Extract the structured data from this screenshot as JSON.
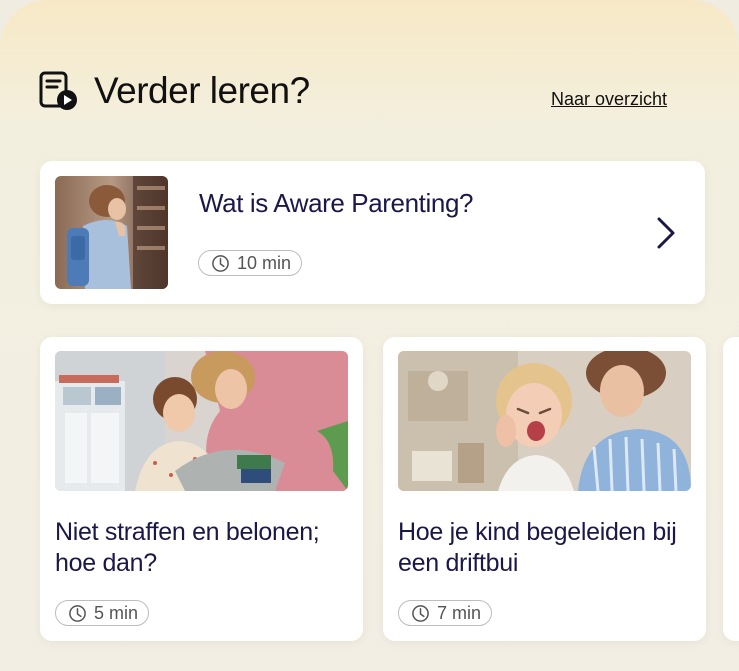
{
  "header": {
    "title": "Verder leren?",
    "overview_link": "Naar overzicht"
  },
  "featured": {
    "title": "Wat is Aware Parenting?",
    "duration": "10 min"
  },
  "cards": [
    {
      "title": "Niet straffen en belonen; hoe dan?",
      "duration": "5 min"
    },
    {
      "title": "Hoe je kind begeleiden bij een driftbui",
      "duration": "7 min"
    }
  ],
  "colors": {
    "title_text": "#1b1848",
    "panel_top": "#f7e9c6",
    "background": "#f2eee4"
  },
  "icons": [
    "lesson-video-icon",
    "clock-icon",
    "chevron-right-icon"
  ]
}
